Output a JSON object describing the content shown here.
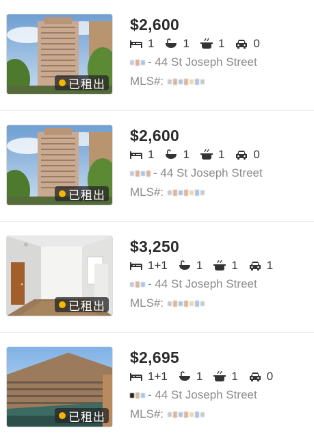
{
  "listings": [
    {
      "price": "$2,600",
      "beds": "1",
      "baths": "1",
      "kitchens": "1",
      "parking": "0",
      "address_street": "- 44 St Joseph Street",
      "mls_label": "MLS#:",
      "status_badge": "已租出",
      "photo": "highrise-exterior-1"
    },
    {
      "price": "$2,600",
      "beds": "1",
      "baths": "1",
      "kitchens": "1",
      "parking": "0",
      "address_street": "- 44 St Joseph Street",
      "mls_label": "MLS#:",
      "status_badge": "已租出",
      "photo": "highrise-exterior-2"
    },
    {
      "price": "$3,250",
      "beds": "1+1",
      "baths": "1",
      "kitchens": "1",
      "parking": "1",
      "address_street": "- 44 St Joseph Street",
      "mls_label": "MLS#:",
      "status_badge": "已租出",
      "photo": "empty-unit-interior"
    },
    {
      "price": "$2,695",
      "beds": "1+1",
      "baths": "1",
      "kitchens": "1",
      "parking": "0",
      "address_street": "- 44 St Joseph Street",
      "mls_label": "MLS#:",
      "status_badge": "已租出",
      "photo": "tower-exterior"
    }
  ],
  "icons": {
    "beds": "bed-icon",
    "baths": "bathtub-icon",
    "kitchens": "kitchen-pot-icon",
    "parking": "car-icon"
  },
  "colors": {
    "badge_dot": "#f5b800",
    "price_text": "#2b2b2b",
    "muted_text": "#8a8a8a"
  }
}
